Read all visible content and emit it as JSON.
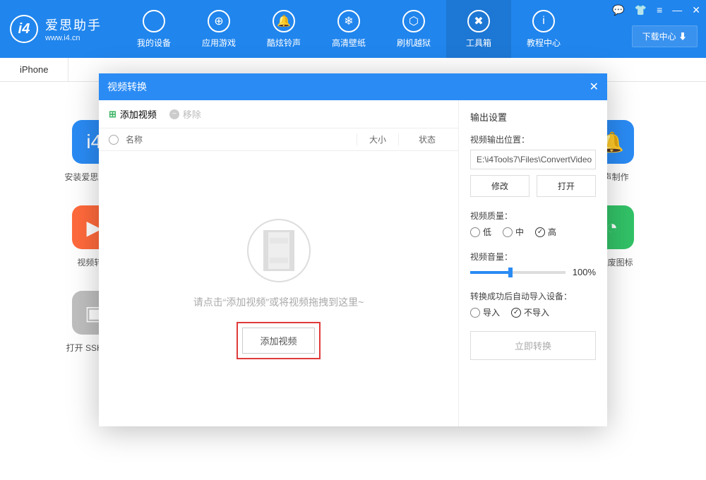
{
  "app": {
    "title": "爱思助手",
    "site": "www.i4.cn"
  },
  "nav": [
    {
      "label": "我的设备"
    },
    {
      "label": "应用游戏"
    },
    {
      "label": "酷炫铃声"
    },
    {
      "label": "高清壁纸"
    },
    {
      "label": "刷机越狱"
    },
    {
      "label": "工具箱",
      "active": true
    },
    {
      "label": "教程中心"
    }
  ],
  "download_center": "下载中心 ⬇",
  "tab": "iPhone",
  "tiles": {
    "r1c1": "安装爱思移动端",
    "r1c6": "铃声制作",
    "r2c1": "视频转换",
    "r2c6": "删除废图标",
    "r3c1": "打开 SSH 通道"
  },
  "modal": {
    "title": "视频转换",
    "toolbar": {
      "add": "添加视频",
      "remove": "移除"
    },
    "cols": {
      "name": "名称",
      "size": "大小",
      "state": "状态"
    },
    "hint": "请点击“添加视频”或将视频拖拽到这里~",
    "add_btn": "添加视频",
    "right": {
      "heading": "输出设置",
      "out_label": "视频输出位置：",
      "out_path": "E:\\i4Tools7\\Files\\ConvertVideo",
      "modify": "修改",
      "open": "打开",
      "quality_label": "视频质量：",
      "q_low": "低",
      "q_mid": "中",
      "q_high": "高",
      "volume_label": "视频音量：",
      "volume_pct": "100%",
      "volume_val": 40,
      "import_label": "转换成功后自动导入设备：",
      "import_yes": "导入",
      "import_no": "不导入",
      "convert": "立即转换"
    }
  }
}
